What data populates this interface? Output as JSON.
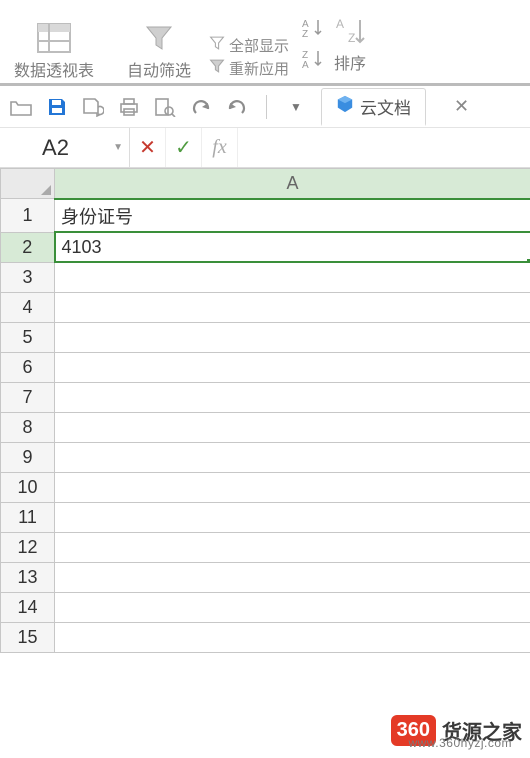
{
  "ribbon": {
    "pivot_label": "数据透视表",
    "auto_filter_label": "自动筛选",
    "show_all_label": "全部显示",
    "reapply_label": "重新应用",
    "sort_label": "排序"
  },
  "cloud_tab": {
    "label": "云文档"
  },
  "name_box": {
    "value": "A2"
  },
  "formula_bar": {
    "fx_label": "fx"
  },
  "columns": [
    "A"
  ],
  "rows": [
    {
      "n": "1",
      "A": "身份证号"
    },
    {
      "n": "2",
      "A": "4103"
    },
    {
      "n": "3",
      "A": ""
    },
    {
      "n": "4",
      "A": ""
    },
    {
      "n": "5",
      "A": ""
    },
    {
      "n": "6",
      "A": ""
    },
    {
      "n": "7",
      "A": ""
    },
    {
      "n": "8",
      "A": ""
    },
    {
      "n": "9",
      "A": ""
    },
    {
      "n": "10",
      "A": ""
    },
    {
      "n": "11",
      "A": ""
    },
    {
      "n": "12",
      "A": ""
    },
    {
      "n": "13",
      "A": ""
    },
    {
      "n": "14",
      "A": ""
    },
    {
      "n": "15",
      "A": ""
    }
  ],
  "active": {
    "col": "A",
    "row": "2"
  },
  "watermark": {
    "badge": "360",
    "main": "货源之家",
    "sub": "www.360hyzj.com"
  }
}
